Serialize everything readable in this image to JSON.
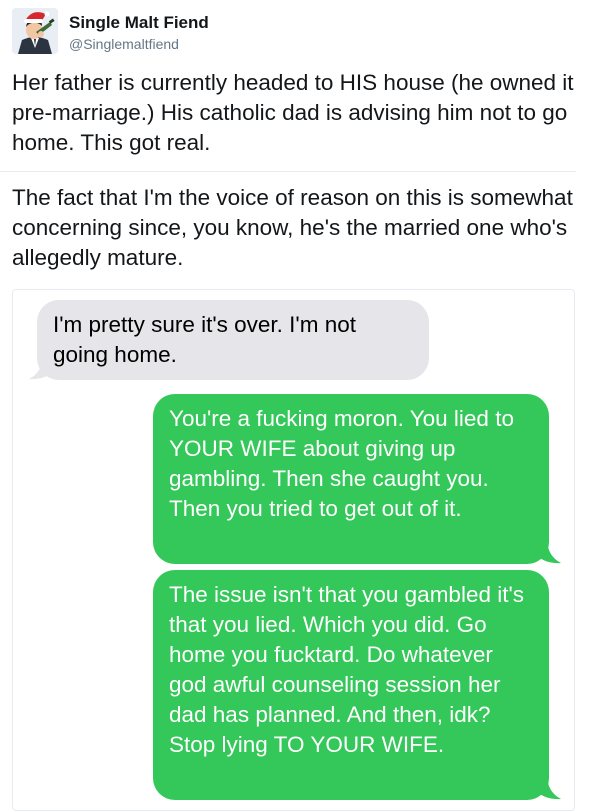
{
  "tweet": {
    "author": {
      "display_name": "Single Malt Fiend",
      "handle": "@Singlemaltfiend"
    },
    "texts": [
      "Her father is currently headed to HIS house (he owned it pre-marriage.) His catholic dad is advising him not to go home. This got real.",
      "The fact that I'm the voice of reason on this is somewhat concerning since, you know, he's the married one who's allegedly mature."
    ]
  },
  "conversation": {
    "messages": [
      {
        "direction": "incoming",
        "text": "I'm pretty sure it's over. I'm not going home."
      },
      {
        "direction": "outgoing",
        "text": "You're a fucking moron. You lied to YOUR WIFE about giving up gambling. Then she caught you. Then you tried to get out of it."
      },
      {
        "direction": "outgoing",
        "text": "The issue isn't that you gambled it's that you lied. Which you did. Go home you fucktard. Do whatever god awful counseling session her dad has planned. And then, idk? Stop lying TO YOUR WIFE."
      }
    ]
  },
  "colors": {
    "incoming_bubble": "#e5e5ea",
    "outgoing_bubble": "#34c759",
    "handle_gray": "#657786"
  },
  "icons": {
    "avatar": "cartoon-man-with-santa-hat-drinking-avatar"
  }
}
